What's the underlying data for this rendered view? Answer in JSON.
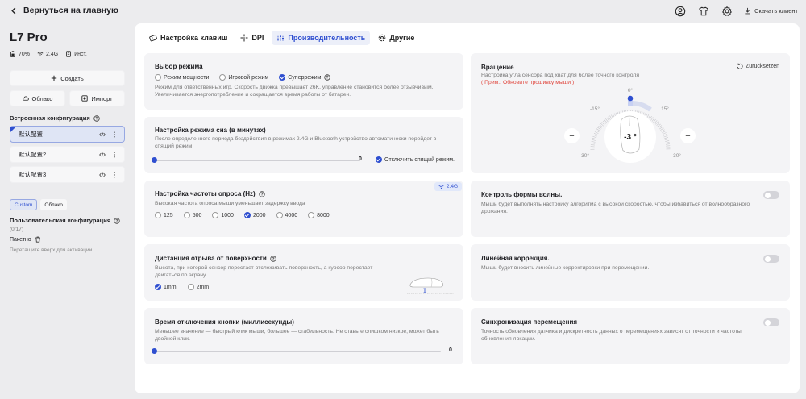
{
  "header": {
    "back_label": "Вернуться на главную",
    "download_label": "Скачать клиент"
  },
  "device": {
    "name": "L7 Pro",
    "battery": "70%",
    "connection": "2.4G",
    "extra": "инст."
  },
  "sidebar": {
    "create_label": "Создать",
    "cloud_label": "Облако",
    "import_label": "Импорт",
    "builtin_title": "Встроенная конфигурация",
    "configs": [
      {
        "label": "默认配置",
        "active": true
      },
      {
        "label": "默认配置2",
        "active": false
      },
      {
        "label": "默认配置3",
        "active": false
      }
    ],
    "small_tabs": [
      "Custom",
      "Облако"
    ],
    "user_title": "Пользовательская конфигурация",
    "user_count": "(0/17)",
    "batch_label": "Пакетно",
    "hint": "Перетащите вверх для активации"
  },
  "tabs": [
    {
      "label": "Настройка клавиш",
      "icon": "keyboard-icon"
    },
    {
      "label": "DPI",
      "icon": "crosshair-icon"
    },
    {
      "label": "Производительность",
      "icon": "sliders-icon",
      "active": true
    },
    {
      "label": "Другие",
      "icon": "gear-icon"
    }
  ],
  "mode": {
    "title": "Выбор режима",
    "options": [
      "Режим мощности",
      "Игровой режим",
      "Суперрежим"
    ],
    "selected": "Суперрежим",
    "desc": "Режим для ответственных игр. Скорость движка превышает 26K, управление становится более отзывчивым. Увеличивается энергопотребление и сокращается время работы от батареи."
  },
  "sleep": {
    "title": "Настройка режима сна (в минутах)",
    "desc": "После определенного периода бездействия в режимах 2.4G и Bluetooth устройство автоматически перейдет в спящий режим.",
    "value": "0",
    "level": 0,
    "disable_label": "Отключить спящий режим."
  },
  "polling": {
    "title": "Настройка частоты опроса (Hz)",
    "desc": "Высокая частота опроса мыши уменьшает задержку ввода",
    "badge": "2.4G",
    "options": [
      "125",
      "500",
      "1000",
      "2000",
      "4000",
      "8000"
    ],
    "selected": "2000"
  },
  "lod": {
    "title": "Дистанция отрыва от поверхности",
    "desc": "Высота, при которой сенсор перестает отслеживать поверхность, а курсор перестает двигаться по экрану.",
    "options": [
      "1mm",
      "2mm"
    ],
    "selected": "1mm"
  },
  "debounce": {
    "title": "Время отключения кнопки (миллисекунды)",
    "desc": "Меньшее значение — быстрый клик мыши, большее — стабильность. Не ставьте слишком низкое, может быть двойной клик.",
    "value": "0",
    "level": 0
  },
  "rotation": {
    "title": "Вращение",
    "reset_label": "Zurücksetzen",
    "desc": "Настройка угла сенсора под хват для более точного контроля",
    "warn": "( Прим.: Обновите прошивку мыши )",
    "value": "-3 °",
    "ticks": [
      "0°",
      "15°",
      "-15°",
      "30°",
      "-30°"
    ]
  },
  "wave": {
    "title": "Контроль формы волны.",
    "desc": "Мышь будет выполнять настройку алгоритма с высокой скоростью, чтобы избавиться от волнообразного дрожания.",
    "enabled": false
  },
  "linear": {
    "title": "Линейная коррекция.",
    "desc": "Мышь будет вносить линейные корректировки при перемещении.",
    "enabled": false
  },
  "motion_sync": {
    "title": "Синхронизация перемещения",
    "desc": "Точность обновления датчика и дискретность данных о перемещениях зависят от точности и частоты обновления локации.",
    "enabled": false
  },
  "colors": {
    "accent": "#2f4fd0",
    "warn": "#e0473e"
  }
}
